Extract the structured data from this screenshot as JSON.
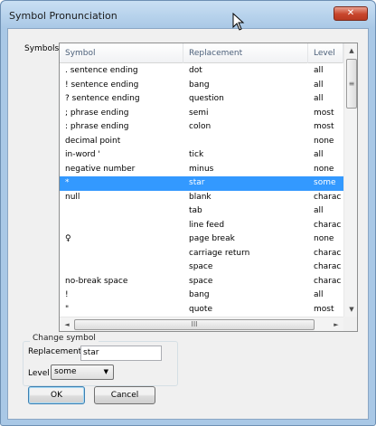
{
  "window": {
    "title": "Symbol Pronunciation",
    "close_label": "✕"
  },
  "symbols_label": "Symbols",
  "columns": {
    "symbol": "Symbol",
    "replacement": "Replacement",
    "level": "Level"
  },
  "rows": [
    {
      "symbol": ". sentence ending",
      "replacement": "dot",
      "level": "all"
    },
    {
      "symbol": "! sentence ending",
      "replacement": "bang",
      "level": "all"
    },
    {
      "symbol": "? sentence ending",
      "replacement": "question",
      "level": "all"
    },
    {
      "symbol": "; phrase ending",
      "replacement": "semi",
      "level": "most"
    },
    {
      "symbol": ": phrase ending",
      "replacement": "colon",
      "level": "most"
    },
    {
      "symbol": "decimal point",
      "replacement": "",
      "level": "none"
    },
    {
      "symbol": "in-word '",
      "replacement": "tick",
      "level": "all"
    },
    {
      "symbol": "negative number",
      "replacement": "minus",
      "level": "none"
    },
    {
      "symbol": "*",
      "replacement": "star",
      "level": "some"
    },
    {
      "symbol": "null",
      "replacement": "blank",
      "level": "charac"
    },
    {
      "symbol": "",
      "replacement": "tab",
      "level": "all"
    },
    {
      "symbol": "",
      "replacement": "line feed",
      "level": "charac"
    },
    {
      "symbol": "♀",
      "replacement": "page break",
      "level": "none"
    },
    {
      "symbol": "",
      "replacement": "carriage return",
      "level": "charac"
    },
    {
      "symbol": "",
      "replacement": "space",
      "level": "charac"
    },
    {
      "symbol": "no-break space",
      "replacement": "space",
      "level": "charac"
    },
    {
      "symbol": "!",
      "replacement": "bang",
      "level": "all"
    },
    {
      "symbol": "\"",
      "replacement": "quote",
      "level": "most"
    }
  ],
  "selected_row": 8,
  "scrollbar": {
    "up": "▲",
    "down": "▼",
    "left": "◄",
    "right": "►",
    "grip_v": "≡",
    "grip_h": "III"
  },
  "change_symbol": {
    "legend": "Change symbol",
    "replacement_label": "Replacement",
    "replacement_value": "star",
    "level_label": "Level",
    "level_value": "some",
    "level_arrow": "▼"
  },
  "buttons": {
    "ok": "OK",
    "cancel": "Cancel"
  },
  "colors": {
    "selection": "#3399ff",
    "title_bar": "#a9c8e6",
    "close": "#c8452c"
  }
}
